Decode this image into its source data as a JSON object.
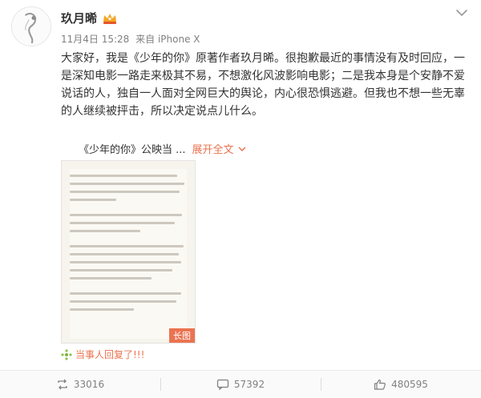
{
  "post": {
    "username": "玖月晞",
    "date": "11月4日 15:28",
    "source": "来自 iPhone X",
    "text": "大家好，我是《少年的你》原著作者玖月晞。很抱歉最近的事情没有及时回应，一是深知电影一路走来极其不易，不想激化风波影响电影；二是我本身是个安静不爱说话的人，独自一人面对全网巨大的舆论，内心很恐惧逃避。但我也不想一些无辜的人继续被抨击，所以决定说点儿什么。",
    "collapsed_preview": "《少年的你》公映当 ...",
    "expand_label": "展开全文",
    "long_image_badge": "长图",
    "party_reply": "当事人回复了!!!"
  },
  "actions": {
    "repost_count": "33016",
    "comment_count": "57392",
    "like_count": "480595"
  },
  "icons": {
    "menu": "chevron-down-icon",
    "vip": "crown-badge-icon",
    "repost": "repost-icon",
    "comment": "comment-icon",
    "like": "thumbs-up-icon",
    "reply": "sparkle-icon"
  },
  "colors": {
    "accent": "#eb7350",
    "text": "#333333",
    "meta": "#808080"
  }
}
